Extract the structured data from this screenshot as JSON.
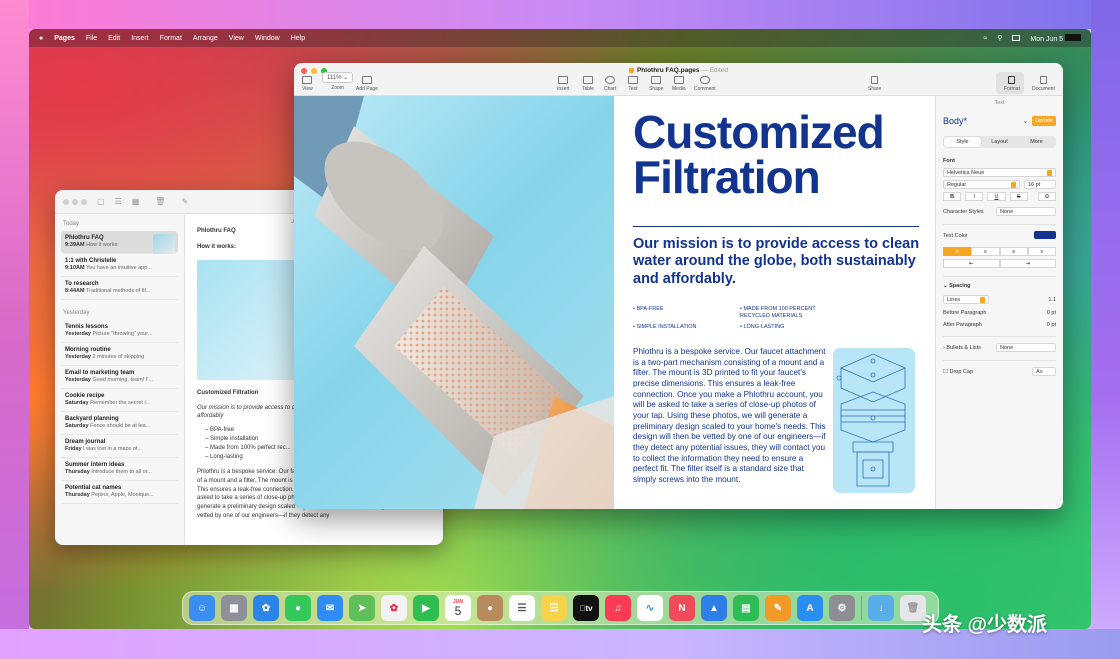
{
  "menubar": {
    "app_name": "Pages",
    "items": [
      "File",
      "Edit",
      "Insert",
      "Format",
      "Arrange",
      "View",
      "Window",
      "Help"
    ],
    "clock": "Mon Jun 5"
  },
  "notes": {
    "toolbar_font_label": "Aa",
    "list_groups": [
      {
        "heading": "Today",
        "items": [
          {
            "title": "Phlothru FAQ",
            "time": "9:39AM",
            "preview": "How it works:"
          },
          {
            "title": "1:1 with Christelle",
            "time": "9:10AM",
            "preview": "You have an intuitive app..."
          },
          {
            "title": "To research",
            "time": "8:44AM",
            "preview": "Traditional methods of fil..."
          }
        ]
      },
      {
        "heading": "Yesterday",
        "items": [
          {
            "title": "Tennis lessons",
            "time": "Yesterday",
            "preview": "Picture \"throwing\" your..."
          },
          {
            "title": "Morning routine",
            "time": "Yesterday",
            "preview": "2 minutes of skipping"
          },
          {
            "title": "Email to marketing team",
            "time": "Yesterday",
            "preview": "Good morning, team! I'..."
          },
          {
            "title": "Cookie recipe",
            "time": "Saturday",
            "preview": "Remember the secret i..."
          },
          {
            "title": "Backyard planning",
            "time": "Saturday",
            "preview": "Fence should be at lea..."
          },
          {
            "title": "Dream journal",
            "time": "Friday",
            "preview": "I was lost in a maze of..."
          },
          {
            "title": "Summer intern ideas",
            "time": "Thursday",
            "preview": "Introduce them to all or..."
          },
          {
            "title": "Potential cat names",
            "time": "Thursday",
            "preview": "Pepins, Apple, Monique..."
          }
        ]
      }
    ],
    "body": {
      "date_label": "June",
      "title": "Phlothru FAQ",
      "how": "How it works:",
      "heading": "Customized Filtration",
      "mission": "Our mission is to provide access to clean water around the globe, both sustainably and affordably",
      "bullets": [
        "BPA-free",
        "Simple installation",
        "Made from 100% perfect rec...",
        "Long-lasting"
      ],
      "para": "Phlothru is a bespoke service. Our faucet attachment is a two-part mechanism consisting of a mount and a filter. The mount is 3D printed to fit your faucet's precise dimensions. This ensures a leak-free connection. Once you make a Phlothru account, you will be asked to take a series of close-up photos of your tap. Using these photos, we will generate a preliminary design scaled to your home's needs. This design will then be vetted by one of our engineers—if they detect any"
    }
  },
  "pages": {
    "doc_name": "Phlothru FAQ.pages",
    "doc_state": "— Edited",
    "toolbar_left": [
      {
        "label": "View",
        "icon": "sidebar-icon"
      },
      {
        "label": "Zoom",
        "value": "111%",
        "icon": "zoom-icon"
      },
      {
        "label": "Add Page",
        "icon": "add-page-icon"
      }
    ],
    "toolbar_center": [
      {
        "label": "Insert",
        "icon": "insert-icon"
      },
      {
        "label": "Table",
        "icon": "table-icon"
      },
      {
        "label": "Chart",
        "icon": "chart-icon"
      },
      {
        "label": "Text",
        "icon": "text-icon"
      },
      {
        "label": "Shape",
        "icon": "shape-icon"
      },
      {
        "label": "Media",
        "icon": "media-icon"
      },
      {
        "label": "Comment",
        "icon": "comment-icon"
      }
    ],
    "share_label": "Share",
    "toolbar_right": [
      {
        "label": "Format",
        "icon": "paintbrush-icon"
      },
      {
        "label": "Document",
        "icon": "document-icon"
      }
    ],
    "document": {
      "headline_line1": "Customized",
      "headline_line2": "Filtration",
      "mission": "Our mission is to provide access to clean water around the globe, both sustainably and affordably.",
      "features": [
        "BPA-FREE",
        "MADE FROM 100 PERCENT RECYCLED MATERIALS",
        "SIMPLE INSTALLATION",
        "LONG-LASTING"
      ],
      "body": "Phlothru is a bespoke service. Our faucet attachment is a two-part mechanism consisting of a mount and a filter. The mount is 3D printed to fit your faucet's precise dimensions. This ensures a leak-free connection. Once you make a Phlothru account, you will be asked to take a series of close-up photos of your tap. Using these photos, we will generate a preliminary design scaled to your home's needs. This design will then be vetted by one of our engineers—if they detect any potential issues, they will contact you to collect the information they need to ensure a perfect fit. The filter itself is a standard size that simply screws into the mount."
    },
    "inspector": {
      "header": "Text",
      "paragraph_style": "Body*",
      "update_label": "Update",
      "tabs": [
        "Style",
        "Layout",
        "More"
      ],
      "active_tab": "Style",
      "font_label": "Font",
      "font_name": "Helvetica Neue",
      "font_weight": "Regular",
      "font_size": "16 pt",
      "format_buttons": [
        "B",
        "I",
        "U",
        "S"
      ],
      "char_styles_label": "Character Styles",
      "char_styles_value": "None",
      "text_color_label": "Text Color",
      "text_color": "#12348f",
      "spacing_label": "Spacing",
      "spacing_mode": "Lines",
      "spacing_value": "1.1",
      "before_paragraph_label": "Before Paragraph",
      "before_paragraph_value": "0 pt",
      "after_paragraph_label": "After Paragraph",
      "after_paragraph_value": "0 pt",
      "bullets_label": "Bullets & Lists",
      "bullets_value": "None",
      "drop_cap_label": "Drop Cap"
    }
  },
  "dock": {
    "apps": [
      {
        "name": "finder-icon",
        "color": "#3a8ef0"
      },
      {
        "name": "launchpad-icon",
        "color": "#8f8f9a"
      },
      {
        "name": "safari-icon",
        "color": "#2b84e8"
      },
      {
        "name": "messages-icon",
        "color": "#34c759"
      },
      {
        "name": "mail-icon",
        "color": "#2f8cf2"
      },
      {
        "name": "maps-icon",
        "color": "#5fbf58"
      },
      {
        "name": "photos-icon",
        "color": "#f2f2f2"
      },
      {
        "name": "facetime-icon",
        "color": "#2fbe4f"
      },
      {
        "name": "calendar-icon",
        "color": "#ffffff"
      },
      {
        "name": "contacts-icon",
        "color": "#b88a5c"
      },
      {
        "name": "reminders-icon",
        "color": "#ffffff"
      },
      {
        "name": "notes-icon",
        "color": "#f7d34a"
      },
      {
        "name": "tv-icon",
        "color": "#111111"
      },
      {
        "name": "music-icon",
        "color": "#fa3b53"
      },
      {
        "name": "freeform-icon",
        "color": "#ffffff"
      },
      {
        "name": "news-icon",
        "color": "#f14a5b"
      },
      {
        "name": "keynote-icon",
        "color": "#2d7ee6"
      },
      {
        "name": "numbers-icon",
        "color": "#2ebc57"
      },
      {
        "name": "pages-icon",
        "color": "#f29a28"
      },
      {
        "name": "app-store-icon",
        "color": "#2a8ef0"
      },
      {
        "name": "system-settings-icon",
        "color": "#8d8d94"
      }
    ],
    "calendar_month": "JUN",
    "calendar_day": "5",
    "tv_label": "tv",
    "trailing": [
      {
        "name": "downloads-folder-icon",
        "color": "#5aaee8"
      },
      {
        "name": "trash-icon",
        "color": "#e6e6ea"
      }
    ]
  },
  "watermark": "头条 @少数派"
}
